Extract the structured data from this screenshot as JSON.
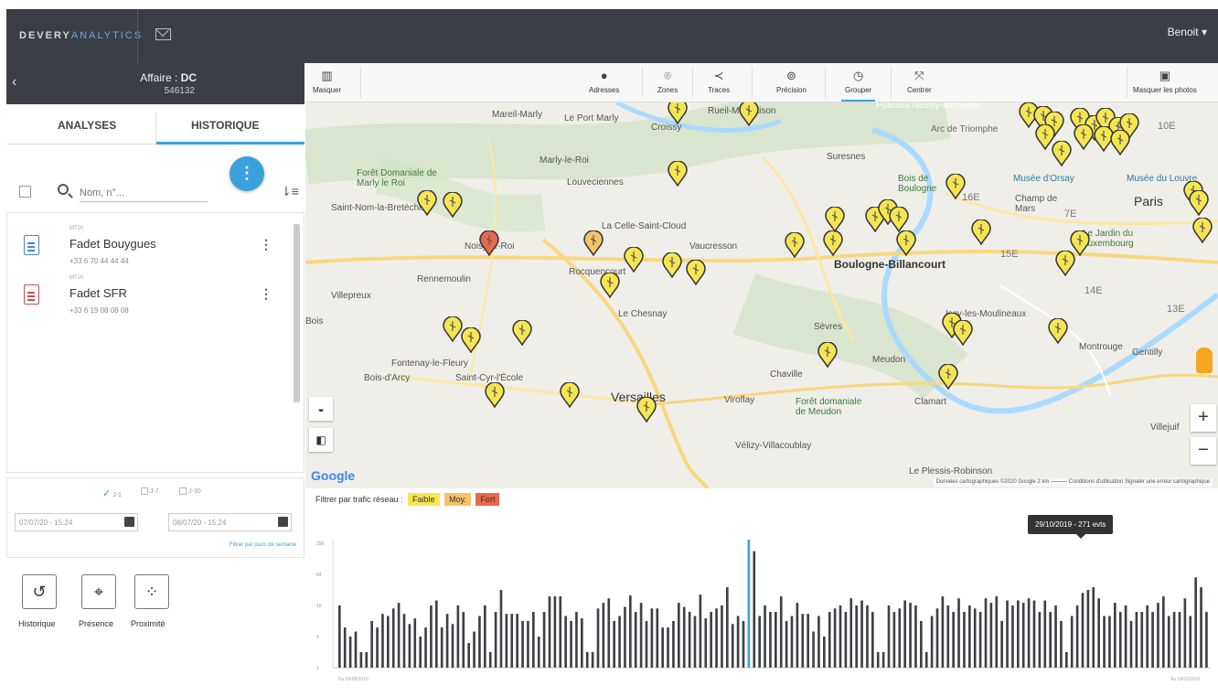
{
  "header": {
    "logo_part1": "DEVERY",
    "logo_part2": "ANALYTICS",
    "user_label": "Benoit ▾"
  },
  "affaire": {
    "label": "Affaire : ",
    "name": "DC",
    "number": "546132"
  },
  "tabs": [
    "ANALYSES",
    "HISTORIQUE"
  ],
  "search": {
    "placeholder": "Nom, n°..."
  },
  "list": [
    {
      "tiny": "MT20",
      "title": "Fadet Bouygues",
      "sub": "+33 6 70 44 44 44",
      "icon": "blue"
    },
    {
      "tiny": "MT20",
      "title": "Fadet SFR",
      "sub": "+33 6 19 08 08 08",
      "icon": "red"
    }
  ],
  "ranges": [
    "J-1",
    "J-7",
    "J-30"
  ],
  "dates": {
    "from": "07/07/20 - 15:24",
    "to": "08/07/20 - 15:24",
    "filter_link": "Filtrer par jours de semaine"
  },
  "tools": [
    "Historique",
    "Présence",
    "Proximité"
  ],
  "map_toolbar": {
    "masquer": "Masquer",
    "items": [
      "Adresses",
      "Zones",
      "Traces",
      "Précision",
      "Grouper",
      "Centrer"
    ],
    "active": "Grouper",
    "masquer_photos": "Masquer les photos"
  },
  "map": {
    "labels": {
      "marnes": "Mareil-Marly",
      "port_marly": "Le Port Marly",
      "croissy": "Croissy",
      "rueil": "Rueil-Malmaison",
      "neuilly": "Puteaux Neuilly-sur-Seine",
      "arc": "Arc de Triomphe",
      "foret_marly": "Forêt Domaniale de Marly le Roi",
      "marly": "Marly-le-Roi",
      "louveciennes": "Louveciennes",
      "bois_boulogne": "Bois de Boulogne",
      "musee_orsay": "Musée d'Orsay",
      "musee_louvre": "Musée du Louvre",
      "saint_nom": "Saint-Nom-la-Bretèche",
      "suresnes": "Suresnes",
      "paris": "Paris",
      "champ": "Champ de Mars",
      "celle": "La Celle-Saint-Cloud",
      "noisy": "Noisy-le-Roi",
      "rennemoulin": "Rennemoulin",
      "rocquencourt": "Rocquencourt",
      "vaucresson": "Vaucresson",
      "boulogne": "Boulogne-Billancourt",
      "jardin": "Le Jardin du Luxembourg",
      "villepreux": "Villepreux",
      "chesnay": "Le Chesnay",
      "bois": "Bois",
      "issy": "Issy-les-Moulineaux",
      "sevres": "Sèvres",
      "fontenay": "Fontenay-le-Fleury",
      "meudon": "Meudon",
      "gentilly": "Gentilly",
      "bois_arcy": "Bois-d'Arcy",
      "saint_cyr": "Saint-Cyr-l'École",
      "chaville": "Chaville",
      "versailles": "Versailles",
      "viroflay": "Viroflay",
      "foret_meudon": "Forêt domaniale de Meudon",
      "clamart": "Clamart",
      "velizy": "Vélizy-Villacoublay",
      "plessis": "Le Plessis-Robinson",
      "montrouge": "Montrouge",
      "villejuif": "Villejuif",
      "a16e": "16E",
      "a15e": "15E",
      "a14e": "14E",
      "a13e": "13E",
      "a7e": "7E",
      "a10e": "10E"
    },
    "attribution": "Données cartographiques ©2020 Google   2 km ⎯⎯⎯⎯⎯⎯   Conditions d'utilisation   Signaler une erreur cartographique",
    "google": "Google",
    "zoom_in": "+",
    "zoom_out": "−"
  },
  "traffic": {
    "label": "Filtrer par trafic réseau :",
    "levels": [
      {
        "name": "Faible",
        "color": "#f5e552"
      },
      {
        "name": "Moy.",
        "color": "#f6c36a"
      },
      {
        "name": "Fort",
        "color": "#e9694c"
      }
    ]
  },
  "chart_data": {
    "type": "bar",
    "tooltip": "29/10/2019 - 271 evts",
    "highlight_index": 76,
    "y_ticks": [
      "256",
      "64",
      "16",
      "4",
      "1"
    ],
    "x_start": "Du 03/08/2019",
    "x_end": "Au 19/11/2019",
    "values": [
      16,
      6,
      4,
      5,
      2,
      2,
      8,
      6,
      11,
      10,
      14,
      18,
      11,
      7,
      9,
      4,
      6,
      16,
      20,
      6,
      11,
      7,
      16,
      12,
      3,
      5,
      10,
      16,
      2,
      12,
      32,
      11,
      11,
      11,
      8,
      8,
      12,
      4,
      12,
      24,
      24,
      24,
      10,
      8,
      12,
      9,
      2,
      2,
      14,
      18,
      22,
      8,
      10,
      15,
      25,
      12,
      18,
      8,
      14,
      14,
      6,
      6,
      8,
      18,
      15,
      12,
      10,
      26,
      9,
      12,
      14,
      16,
      36,
      7,
      10,
      8,
      300,
      180,
      10,
      16,
      12,
      12,
      24,
      8,
      10,
      18,
      11,
      11,
      5,
      10,
      4,
      12,
      14,
      16,
      12,
      22,
      16,
      20,
      16,
      12,
      2,
      2,
      16,
      12,
      14,
      20,
      18,
      16,
      8,
      2,
      10,
      14,
      24,
      16,
      12,
      22,
      12,
      16,
      14,
      12,
      22,
      18,
      24,
      8,
      20,
      16,
      20,
      18,
      22,
      20,
      12,
      20,
      12,
      16,
      8,
      2,
      10,
      16,
      28,
      32,
      36,
      22,
      10,
      10,
      18,
      12,
      16,
      8,
      12,
      12,
      16,
      12,
      18,
      24,
      10,
      12,
      12,
      22,
      10,
      56,
      36,
      12
    ]
  }
}
